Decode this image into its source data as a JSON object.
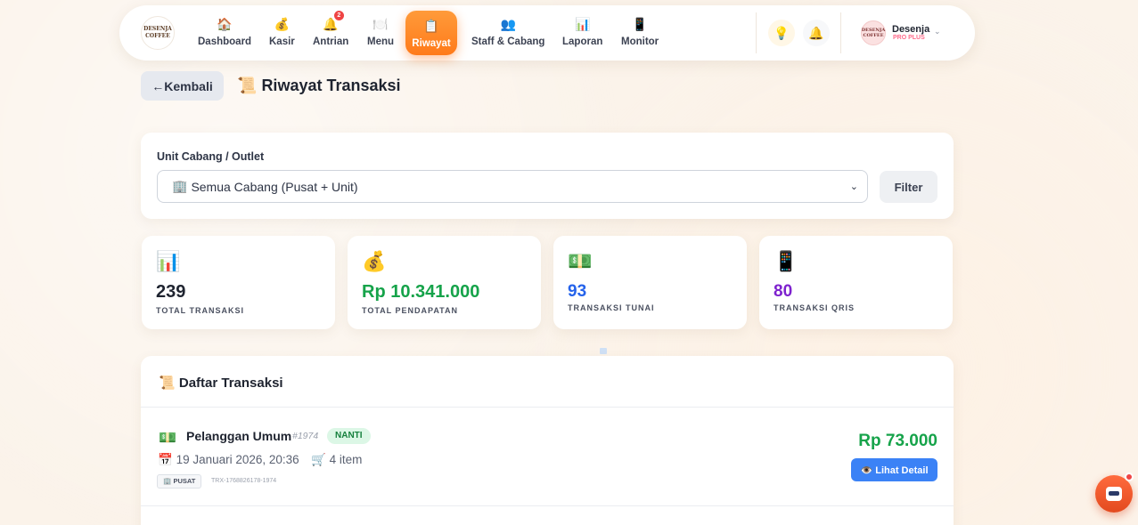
{
  "nav": {
    "logo_text": "DESENJA COFFEE",
    "items": [
      {
        "label": "Dashboard",
        "icon": "🏠"
      },
      {
        "label": "Kasir",
        "icon": "💰"
      },
      {
        "label": "Antrian",
        "icon": "🔔",
        "badge": "2"
      },
      {
        "label": "Menu",
        "icon": "🍽️"
      },
      {
        "label": "Riwayat",
        "icon": "📋"
      },
      {
        "label": "Staff & Cabang",
        "icon": "👥"
      },
      {
        "label": "Laporan",
        "icon": "📊"
      },
      {
        "label": "Monitor",
        "icon": "📱"
      }
    ],
    "active": "Riwayat",
    "tips_icon": "💡",
    "notif_icon": "🔔",
    "user": {
      "name": "Desenja",
      "plan": "PRO PLUS",
      "avatar_text": "DESENJA COFFEE"
    }
  },
  "header": {
    "back_label": "←Kembali",
    "title_icon": "📜",
    "title": "Riwayat Transaksi"
  },
  "filter": {
    "label": "Unit Cabang / Outlet",
    "selected_icon": "🏢",
    "selected": "Semua Cabang (Pusat + Unit)",
    "button": "Filter"
  },
  "stats": [
    {
      "icon": "📊",
      "value": "239",
      "label": "TOTAL TRANSAKSI",
      "color": "#1f2430"
    },
    {
      "icon": "💰",
      "value": "Rp 10.341.000",
      "label": "TOTAL PENDAPATAN",
      "color": "#16a34a"
    },
    {
      "icon": "💵",
      "value": "93",
      "label": "TRANSAKSI TUNAI",
      "color": "#2563eb"
    },
    {
      "icon": "📱",
      "value": "80",
      "label": "TRANSAKSI QRIS",
      "color": "#7e22ce"
    }
  ],
  "list": {
    "title_icon": "📜",
    "title": "Daftar Transaksi",
    "transactions": [
      {
        "icon": "💵",
        "customer": "Pelanggan Umum",
        "id": "#1974",
        "status": "NANTI",
        "date_icon": "📅",
        "date": "19 Januari 2026, 20:36",
        "items_icon": "🛒",
        "items": "4 item",
        "branch": "PUSAT",
        "code": "TRX-1768826178-1974",
        "amount": "Rp 73.000",
        "detail_label": "👁️ Lihat Detail"
      }
    ]
  },
  "colors": {
    "accent": "#ff7a1a",
    "success": "#16a34a",
    "primary": "#3b82f6",
    "background": "#fbf3ea"
  }
}
